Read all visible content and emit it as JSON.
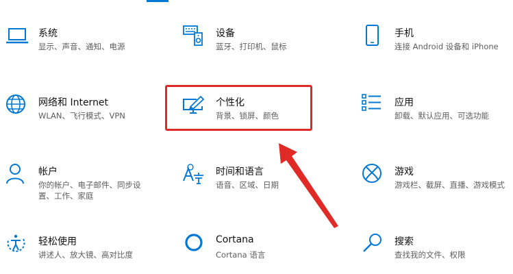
{
  "settings": {
    "tiles": [
      {
        "title": "系统",
        "desc": "显示、声音、通知、电源",
        "icon": "laptop-icon"
      },
      {
        "title": "设备",
        "desc": "蓝牙、打印机、鼠标",
        "icon": "keyboard-speaker-icon"
      },
      {
        "title": "手机",
        "desc": "连接 Android 设备和 iPhone",
        "icon": "phone-icon"
      },
      {
        "title": "网络和 Internet",
        "desc": "WLAN、飞行模式、VPN",
        "icon": "globe-icon"
      },
      {
        "title": "个性化",
        "desc": "背景、锁屏、颜色",
        "icon": "paint-monitor-icon"
      },
      {
        "title": "应用",
        "desc": "卸载、默认应用、可选功能",
        "icon": "app-list-icon"
      },
      {
        "title": "帐户",
        "desc": "你的帐户、电子邮件、同步设置、工作、家庭",
        "desc_lines": [
          "你的帐户、电子邮件、同步设",
          "置、工作、家庭"
        ],
        "icon": "person-icon"
      },
      {
        "title": "时间和语言",
        "desc": "语音、区域、日期",
        "icon": "time-language-icon"
      },
      {
        "title": "游戏",
        "desc": "游戏栏、截屏、直播、游戏模式",
        "icon": "xbox-icon"
      },
      {
        "title": "轻松使用",
        "desc": "讲述人、放大镜、高对比度",
        "icon": "ease-of-access-icon"
      },
      {
        "title": "Cortana",
        "desc": "Cortana 语言",
        "icon": "cortana-icon"
      },
      {
        "title": "搜索",
        "desc": "查找我的文件、权限",
        "icon": "search-icon"
      }
    ]
  },
  "colors": {
    "accent": "#0078d4",
    "highlight": "#e02a26"
  }
}
